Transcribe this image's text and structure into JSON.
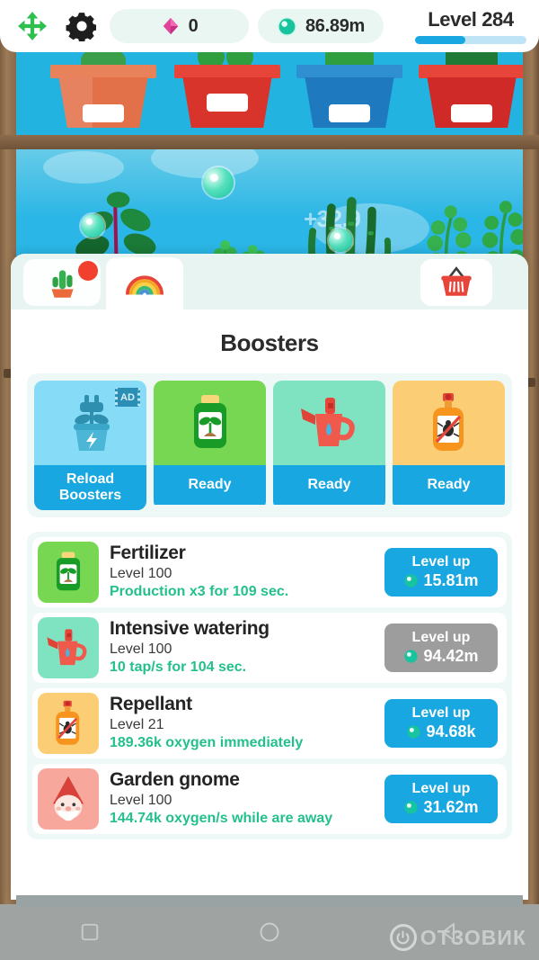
{
  "hud": {
    "move_icon": "move-arrows-icon",
    "settings_icon": "gear-icon",
    "gem_icon": "gem-diamond-icon",
    "gem_value": "0",
    "oxygen_icon": "oxygen-bubble-icon",
    "oxygen_value": "86.89m",
    "level_label": "Level 284",
    "level_progress_percent": 45
  },
  "garden": {
    "floating_number": "+32.9",
    "pots": [
      {
        "name": "terracotta-pot",
        "rim_color": "#e8825a",
        "body_color": "#e2714a"
      },
      {
        "name": "red-pot",
        "rim_color": "#e8453a",
        "body_color": "#d8342c"
      },
      {
        "name": "blue-pot",
        "rim_color": "#2f8fd0",
        "body_color": "#1f79bf"
      },
      {
        "name": "crimson-pot",
        "rim_color": "#e8453a",
        "body_color": "#cf2a28"
      }
    ]
  },
  "tabs": [
    {
      "id": "plants",
      "icon": "cactus-icon",
      "active": false,
      "badge": true
    },
    {
      "id": "boosters",
      "icon": "rainbow-icon",
      "active": true,
      "badge": false
    },
    {
      "id": "shop",
      "icon": "shopping-basket-icon",
      "active": false,
      "badge": false
    }
  ],
  "panel": {
    "title": "Boosters"
  },
  "boosters": [
    {
      "id": "reload-boosters",
      "icon": "plug-plant-icon",
      "art_bg": "#86dcf7",
      "cta": "Reload Boosters",
      "ad_badge": "AD"
    },
    {
      "id": "fertilizer-booster",
      "icon": "fertilizer-bottle-icon",
      "art_bg": "#77d753",
      "cta": "Ready",
      "ad_badge": ""
    },
    {
      "id": "watering-booster",
      "icon": "watering-can-icon",
      "art_bg": "#7fe3c2",
      "cta": "Ready",
      "ad_badge": ""
    },
    {
      "id": "repellant-booster",
      "icon": "repellant-bottle-icon",
      "art_bg": "#fbce75",
      "cta": "Ready",
      "ad_badge": ""
    }
  ],
  "upgrades": [
    {
      "id": "fertilizer",
      "icon": "fertilizer-bottle-icon",
      "icon_bg": "#77d753",
      "title": "Fertilizer",
      "level": "Level 100",
      "effect": "Production x3 for 109 sec.",
      "button_label": "Level up",
      "button_cost": "15.81m",
      "disabled": false
    },
    {
      "id": "intensive-watering",
      "icon": "watering-can-icon",
      "icon_bg": "#7fe3c2",
      "title": "Intensive watering",
      "level": "Level 100",
      "effect": "10 tap/s for 104 sec.",
      "button_label": "Level up",
      "button_cost": "94.42m",
      "disabled": true
    },
    {
      "id": "repellant",
      "icon": "repellant-bottle-icon",
      "icon_bg": "#fbce75",
      "title": "Repellant",
      "level": "Level 21",
      "effect": "189.36k oxygen immediately",
      "button_label": "Level up",
      "button_cost": "94.68k",
      "disabled": false
    },
    {
      "id": "garden-gnome",
      "icon": "gnome-icon",
      "icon_bg": "#f7a79c",
      "title": "Garden gnome",
      "level": "Level 100",
      "effect": "144.74k oxygen/s while are away",
      "button_label": "Level up",
      "button_cost": "31.62m",
      "disabled": false
    }
  ],
  "navbar": {
    "recents_icon": "square-recents-icon",
    "home_icon": "circle-home-icon",
    "back_icon": "triangle-back-icon",
    "watermark_text": "ОТЗОВИК"
  },
  "colors": {
    "accent_blue": "#18a7e0",
    "accent_green": "#23c08e",
    "panel_mint": "#eef8f7",
    "wood": "#8a6a4a",
    "sky": "#2ab6e6"
  }
}
